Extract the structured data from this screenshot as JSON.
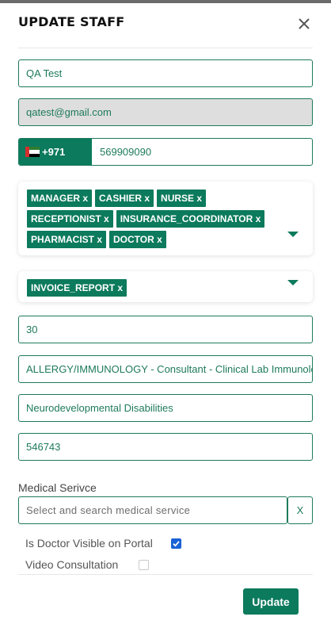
{
  "dialog": {
    "title": "UPDATE STAFF",
    "close_icon": "close-icon"
  },
  "form": {
    "name": "QA Test",
    "email": "qatest@gmail.com",
    "phone": {
      "country_flag": "uae-flag-icon",
      "country_code": "+971",
      "number": "569909090"
    },
    "roles": [
      "MANAGER x",
      "CASHIER x",
      "NURSE x",
      "RECEPTIONIST x",
      "INSURANCE_COORDINATOR x",
      "PHARMACIST x",
      "DOCTOR x"
    ],
    "permissions": [
      "INVOICE_REPORT x"
    ],
    "field_30": "30",
    "specialty": "ALLERGY/IMMUNOLOGY - Consultant - Clinical Lab Immunology",
    "sub_specialty": "Neurodevelopmental Disabilities",
    "license": "546743",
    "medical_service": {
      "label": "Medical Serivce",
      "placeholder": "Select and search medical service",
      "clear_label": "X"
    },
    "checkboxes": {
      "visible_on_portal": {
        "label": "Is Doctor Visible on Portal",
        "checked": true
      },
      "video_consultation": {
        "label": "Video Consultation",
        "checked": false
      }
    }
  },
  "actions": {
    "update_label": "Update"
  },
  "colors": {
    "accent": "#0c7a5c",
    "text_green": "#1e7a5c",
    "checkbox_blue": "#1a62d6",
    "disabled_bg": "#dedede"
  }
}
